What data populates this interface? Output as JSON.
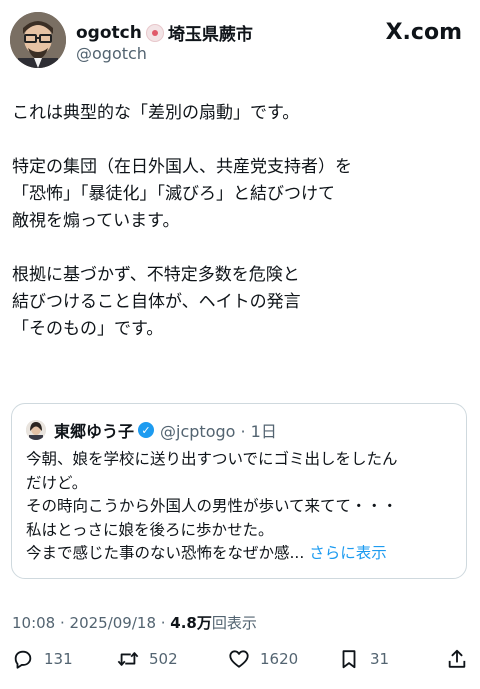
{
  "author": {
    "name": "ogotch",
    "location": "埼玉県蕨市",
    "handle": "@ogotch"
  },
  "site_label": "X.com",
  "post": {
    "lines": [
      "これは典型的な「差別の扇動」です。",
      "",
      "特定の集団（在日外国人、共産党支持者）を",
      "「恐怖」「暴徒化」「滅びろ」と結びつけて",
      "敵視を煽っています。",
      "",
      "根拠に基づかず、不特定多数を危険と",
      "結びつけること自体が、ヘイトの発言",
      "「そのもの」です。"
    ]
  },
  "quoted": {
    "name": "東郷ゆう子",
    "verified_icon": "verified-badge-icon",
    "handle_time": "@jcptogo · 1日",
    "lines": [
      "今朝、娘を学校に送り出すついでにゴミ出しをしたん",
      "だけど。",
      "その時向こうから外国人の男性が歩いて来てて・・・",
      "私はとっさに娘を後ろに歩かせた。",
      "今まで感じた事のない恐怖をなぜか感..."
    ],
    "more_label": "さらに表示"
  },
  "meta": {
    "datetime": "10:08 · 2025/09/18 · ",
    "views_count": "4.8万",
    "views_label": "回表示"
  },
  "actions": {
    "reply": {
      "icon": "reply-icon",
      "count": "131"
    },
    "repost": {
      "icon": "repost-icon",
      "count": "502"
    },
    "like": {
      "icon": "heart-icon",
      "count": "1620"
    },
    "bookmark": {
      "icon": "bookmark-icon",
      "count": "31"
    },
    "share": {
      "icon": "share-icon"
    }
  },
  "colors": {
    "text": "#0f1419",
    "secondary": "#536471",
    "accent": "#1d9bf0",
    "border": "#cfd9de"
  }
}
